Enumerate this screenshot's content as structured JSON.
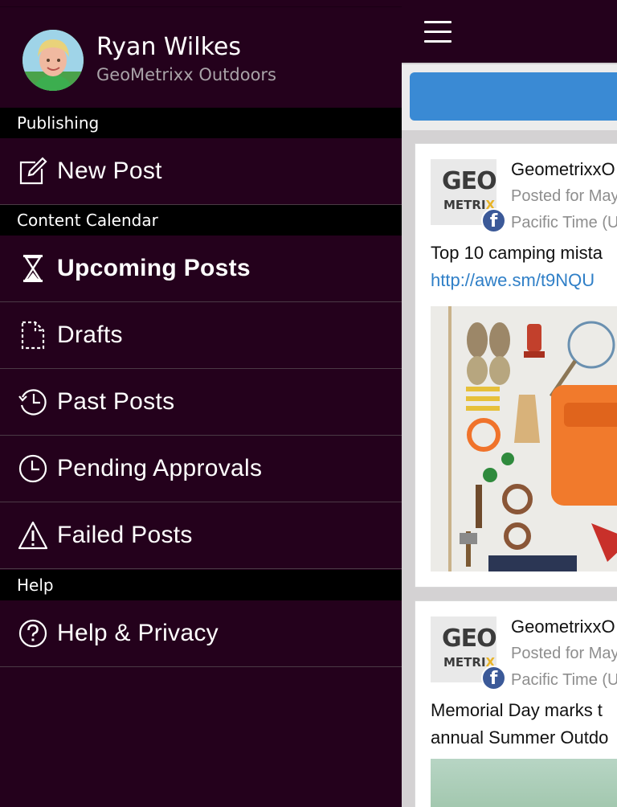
{
  "profile": {
    "name": "Ryan Wilkes",
    "organization": "GeoMetrixx Outdoors"
  },
  "menu": {
    "sections": [
      {
        "label": "Publishing"
      },
      {
        "label": "Content Calendar"
      },
      {
        "label": "Help"
      }
    ],
    "items": [
      {
        "label": "New Post",
        "icon": "edit-icon"
      },
      {
        "label": "Upcoming Posts",
        "icon": "hourglass-icon",
        "active": true
      },
      {
        "label": "Drafts",
        "icon": "draft-document-icon"
      },
      {
        "label": "Past Posts",
        "icon": "history-clock-icon"
      },
      {
        "label": "Pending Approvals",
        "icon": "clock-icon"
      },
      {
        "label": "Failed Posts",
        "icon": "warning-icon"
      },
      {
        "label": "Help & Privacy",
        "icon": "help-icon"
      }
    ]
  },
  "feed": {
    "posts": [
      {
        "logo_top": "GEO",
        "logo_bottom_a": "METRI",
        "logo_bottom_b": "X",
        "network_icon": "facebook-icon",
        "account": "GeometrixxO",
        "posted": "Posted for May",
        "timezone": "Pacific Time (U",
        "text": "Top 10 camping mista",
        "link": "http://awe.sm/t9NQU"
      },
      {
        "logo_top": "GEO",
        "logo_bottom_a": "METRI",
        "logo_bottom_b": "X",
        "network_icon": "facebook-icon",
        "account": "GeometrixxO",
        "posted": "Posted for May",
        "timezone": "Pacific Time (U",
        "text": "Memorial Day marks t",
        "text2": "annual Summer Outdo"
      }
    ]
  },
  "colors": {
    "drawer_bg": "#24011c",
    "section_bg": "#000000",
    "button_blue": "#3a8ad4",
    "link_blue": "#2f7fc7",
    "facebook_blue": "#3b5998"
  }
}
